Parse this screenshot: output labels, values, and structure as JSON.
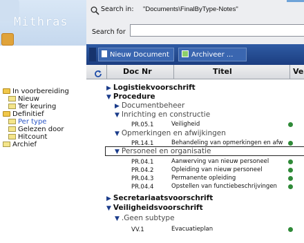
{
  "app": {
    "logo_text": "Mithras"
  },
  "search": {
    "in_label": "Search in:",
    "in_value": "\"Documents\\FinalByType-Notes\"",
    "for_label": "Search for",
    "for_value": ""
  },
  "toolbar": {
    "new_doc": "Nieuw Document",
    "archive": "Archiveer ..."
  },
  "columns": {
    "doc_nr": "Doc Nr",
    "title": "Titel",
    "ve": "Ve"
  },
  "sidebar": {
    "items": [
      {
        "label": "In voorbereiding"
      },
      {
        "label": "Nieuw"
      },
      {
        "label": "Ter keuring"
      },
      {
        "label": "Definitief"
      },
      {
        "label": "Per type"
      },
      {
        "label": "Gelezen door"
      },
      {
        "label": "Hitcount"
      },
      {
        "label": "Archief"
      }
    ]
  },
  "tree": {
    "logistiek": "Logistiekvoorschrift",
    "procedure": "Procedure",
    "documentbeheer": "Documentbeheer",
    "inrichting": "Inrichting en constructie",
    "opmerkingen": "Opmerkingen en afwijkingen",
    "personeel": "Personeel en organisatie",
    "secretariaat": "Secretariaatsvoorschrift",
    "veiligheid": "Veiligheidsvoorschrift",
    "geen_subtype": ".Geen subtype",
    "docs": [
      {
        "nr": "PR.05.1",
        "title": "Veiligheid"
      },
      {
        "nr": "PR.14.1",
        "title": "Behandeling van opmerkingen en afw"
      },
      {
        "nr": "PR.04.1",
        "title": "Aanwerving van nieuw personeel"
      },
      {
        "nr": "PR.04.2",
        "title": "Opleiding van nieuw personeel"
      },
      {
        "nr": "PR.04.3",
        "title": "Permanente opleiding"
      },
      {
        "nr": "PR.04.4",
        "title": "Opstellen van functiebeschrijvingen"
      },
      {
        "nr": "VV.1",
        "title": "Evacuatieplan"
      }
    ]
  }
}
